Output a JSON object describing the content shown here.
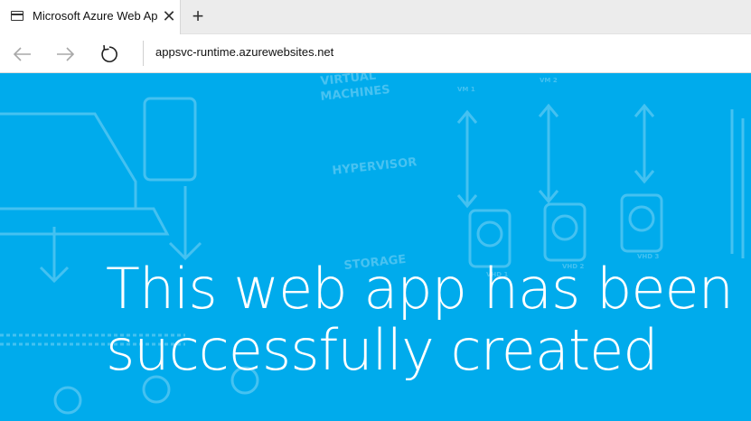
{
  "browser": {
    "tab": {
      "title": "Microsoft Azure Web App",
      "close_glyph": "✕"
    },
    "new_tab_glyph": "+",
    "address": {
      "url": "appsvc-runtime.azurewebsites.net"
    },
    "icons": [
      "tab-page-icon",
      "back-arrow-icon",
      "forward-arrow-icon",
      "refresh-icon"
    ]
  },
  "page": {
    "headline_line1": "This web app has been",
    "headline_line2": "successfully created",
    "background_labels": {
      "virtual": "VIRTUAL",
      "machines": "MACHINES",
      "hypervisor": "HYPERVISOR",
      "storage": "STORAGE",
      "vm1": "VM 1",
      "vm2": "VM 2",
      "vhd1": "VHD 1",
      "vhd2": "VHD 2",
      "vhd3": "VHD 3"
    }
  },
  "colors": {
    "content_background": "#00abec",
    "headline_text": "#ffffff",
    "background_art": "#4cc4f2"
  }
}
